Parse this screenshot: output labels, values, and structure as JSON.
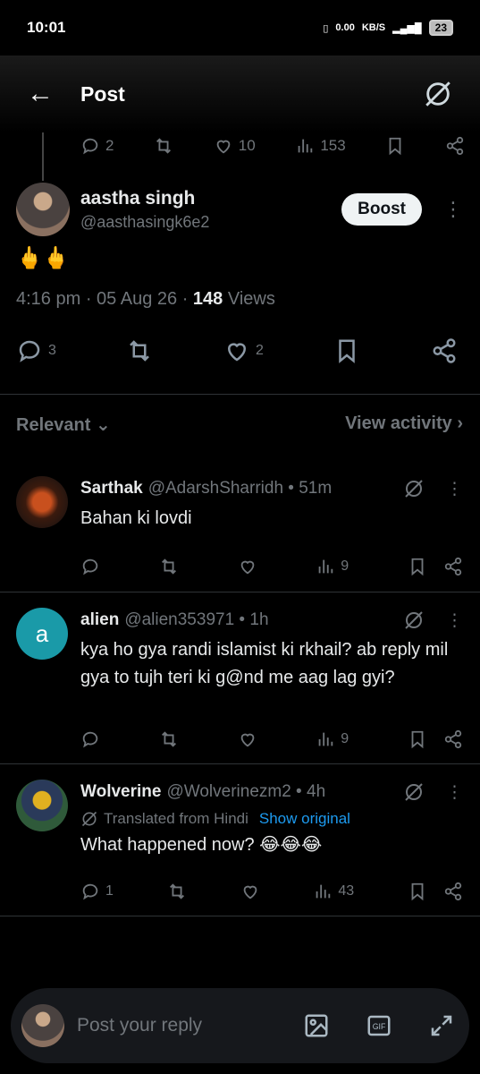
{
  "status_bar": {
    "time": "10:01",
    "net_speed": "0.00",
    "net_unit": "KB/S",
    "battery": "23"
  },
  "header": {
    "title": "Post"
  },
  "prev_post_actions": {
    "replies": "2",
    "likes": "10",
    "views": "153"
  },
  "main_post": {
    "author_name": "aastha singh",
    "author_handle": "@aasthasingk6e2",
    "boost_label": "Boost",
    "content": "🖕🖕",
    "time": "4:16 pm",
    "date": "05 Aug 26",
    "views_count": "148",
    "views_label": "Views",
    "replies": "3",
    "likes": "2"
  },
  "sort": {
    "label": "Relevant",
    "view_activity": "View activity"
  },
  "replies": [
    {
      "name": "Sarthak",
      "handle": "@AdarshSharridh",
      "time": "51m",
      "text": "Bahan ki lovdi",
      "views": "9",
      "replies": "",
      "avatar_color": "#3a1a0e"
    },
    {
      "name": "alien",
      "handle": "@alien353971",
      "time": "1h",
      "text": "kya ho gya randi islamist ki rkhail? ab reply mil gya to tujh teri ki g@nd me aag lag gyi?",
      "views": "9",
      "replies": "",
      "avatar_letter": "a",
      "avatar_color": "#1a9aa8"
    },
    {
      "name": "Wolverine",
      "handle": "@Wolverinezm2",
      "time": "4h",
      "translated_label": "Translated from Hindi",
      "show_original": "Show original",
      "text": "What happened now? 😂😂😂",
      "views": "43",
      "replies": "1",
      "avatar_color": "#2f5a3a"
    }
  ],
  "reply_bar": {
    "placeholder": "Post your reply"
  },
  "colors": {
    "muted": "#71767b",
    "link": "#1d9bf0",
    "bg": "#000000"
  }
}
